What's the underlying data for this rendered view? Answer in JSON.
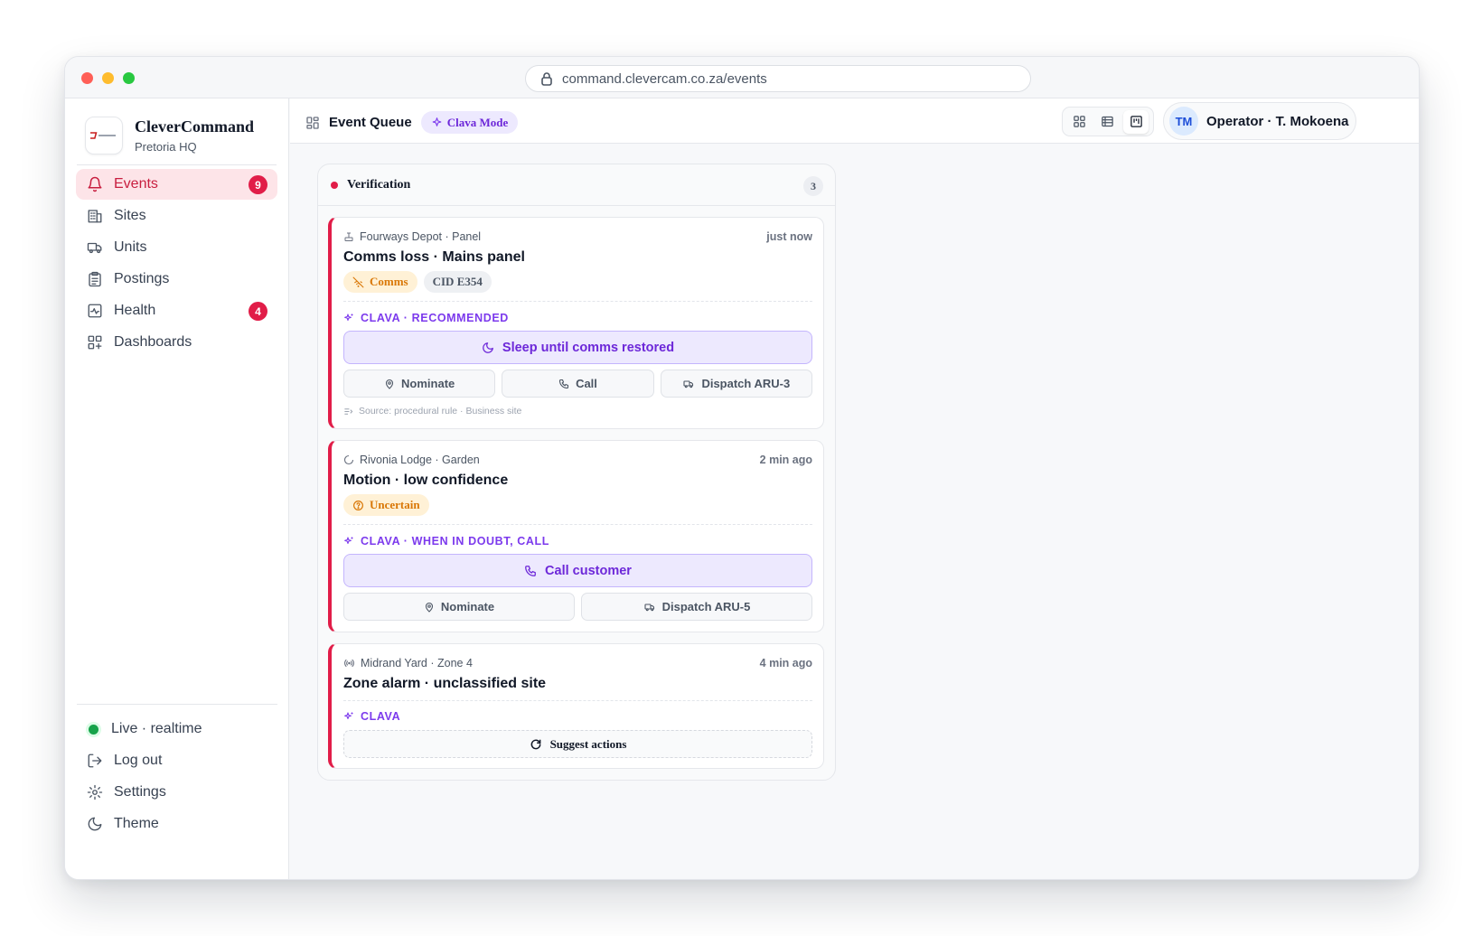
{
  "browser": {
    "url": "command.clevercam.co.za/events"
  },
  "brand": {
    "name": "CleverCommand",
    "location": "Pretoria HQ"
  },
  "sidebar": {
    "items": [
      {
        "label": "Events",
        "icon": "bell-icon",
        "badge": "9",
        "active": true
      },
      {
        "label": "Sites",
        "icon": "building-icon"
      },
      {
        "label": "Units",
        "icon": "truck-icon"
      },
      {
        "label": "Postings",
        "icon": "clipboard-icon"
      },
      {
        "label": "Health",
        "icon": "activity-icon",
        "badge": "4"
      },
      {
        "label": "Dashboards",
        "icon": "dashboard-icon"
      }
    ],
    "bottom": {
      "status": "Live · realtime",
      "logout": "Log out",
      "settings": "Settings",
      "theme": "Theme"
    }
  },
  "topbar": {
    "title": "Event Queue",
    "mode": "Clava Mode",
    "operator_initials": "TM",
    "operator": "Operator · T. Mokoena",
    "active_view": "board"
  },
  "column": {
    "title": "Verification",
    "count": "3",
    "accent": "#e11d48",
    "cards": [
      {
        "meta": "Fourways Depot · Panel",
        "time": "just now",
        "title": "Comms loss · Mains panel",
        "tags": [
          "Comms",
          "CID E354"
        ],
        "clava_label": "CLAVA · RECOMMENDED",
        "primary": "Sleep until comms restored",
        "actions": [
          "Nominate",
          "Call",
          "Dispatch ARU-3"
        ],
        "source": "Source: procedural rule · Business site"
      },
      {
        "meta": "Rivonia Lodge · Garden",
        "time": "2 min ago",
        "title": "Motion · low confidence",
        "tags": [
          "Uncertain"
        ],
        "clava_label": "CLAVA · WHEN IN DOUBT, CALL",
        "primary": "Call customer",
        "actions": [
          "Nominate",
          "Dispatch ARU-5"
        ]
      },
      {
        "meta": "Midrand Yard · Zone 4",
        "time": "4 min ago",
        "title": "Zone alarm · unclassified site",
        "clava_label": "CLAVA",
        "suggest": "Suggest actions"
      }
    ]
  },
  "colors": {
    "accent": "#e11d48",
    "clava": "#7c3aed",
    "amber": "#d97706",
    "live": "#16a34a"
  }
}
